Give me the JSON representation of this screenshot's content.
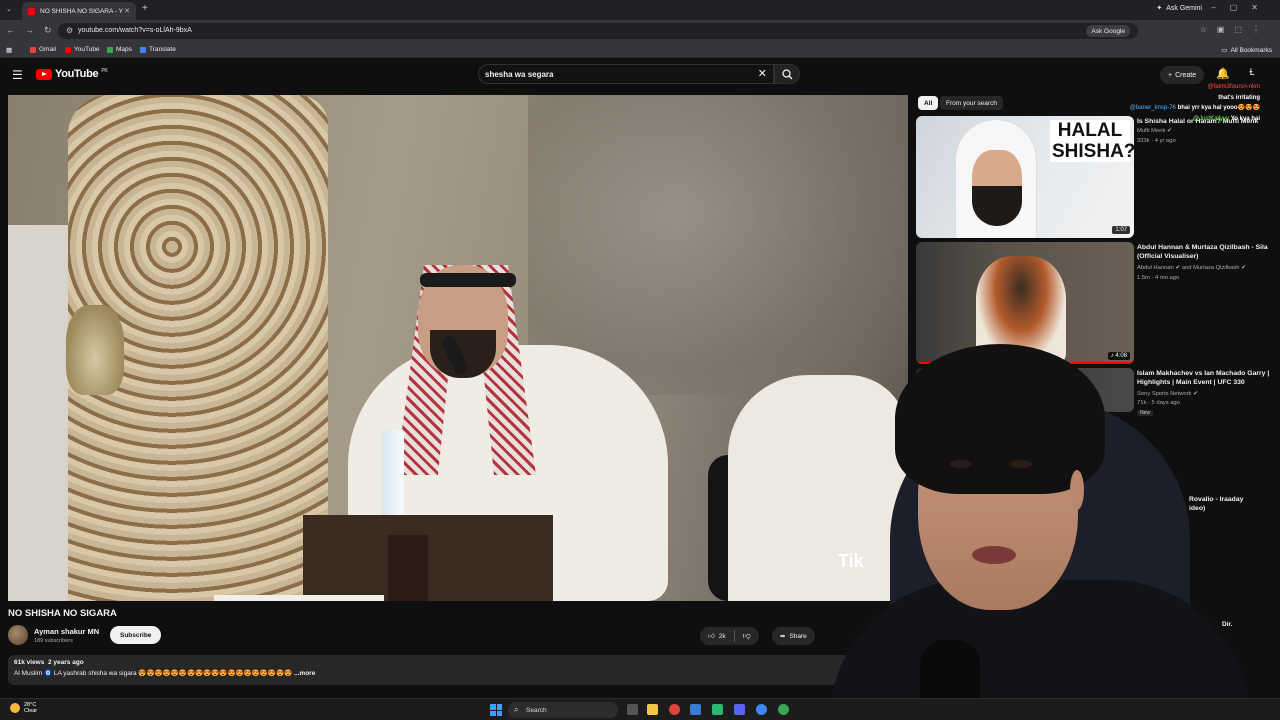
{
  "browser": {
    "tab_title": "NO SHISHA NO SIGARA - Y",
    "new_tab_icon": "plus-icon",
    "ask_gemini": "Ask Gemini",
    "url": "youtube.com/watch?v=s-oLlAh-9bxA",
    "ask_google": "Ask Google",
    "bookmarks": [
      {
        "label": "Gmail",
        "color": "#ea4335"
      },
      {
        "label": "YouTube",
        "color": "#ff0000"
      },
      {
        "label": "Maps",
        "color": "#34a853"
      },
      {
        "label": "Translate",
        "color": "#4285f4"
      }
    ],
    "all_bookmarks": "All Bookmarks"
  },
  "youtube": {
    "logo_text": "YouTube",
    "country": "PK",
    "search_value": "shesha wa segara",
    "create_label": "Create",
    "accent": "#ff0000"
  },
  "video": {
    "title": "NO SHISHA NO SIGARA",
    "watermark": "Tik",
    "channel": "Ayman shakur MN",
    "subscribers": "189 subscribers",
    "subscribe_label": "Subscribe",
    "likes": "2k",
    "share_label": "Share",
    "views": "61k views",
    "age": "2 years ago",
    "description": "Al Muslim 🧿 LA yashrab shisha wa sigara 😍😍😍😍😍😍😍😍😍😍😍😍😍😍😍😍😍😍😍",
    "more_label": "...more"
  },
  "sidebar": {
    "chips": [
      "All",
      "From your search"
    ],
    "items": [
      {
        "title": "Is Shisha Halal or Haram? Mufti Menk",
        "channel": "Mufti Menk",
        "views": "333k",
        "age": "4 yr ago",
        "duration": "1:07",
        "thumb_text": "HALAL SHISHA?"
      },
      {
        "title": "Abdul Hannan & Murtaza Qizilbash - Sila (Official Visualiser)",
        "channel": "Abdul Hannan",
        "channel2": "and Murtaza Qizilbash",
        "views": "1.5m",
        "age": "4 mo ago",
        "duration": "4:08"
      },
      {
        "title": "Islam Makhachev vs Ian Machado Garry | Highlights | Main Event | UFC 330",
        "channel": "Sony Sports Network",
        "views": "71k",
        "age": "5 days ago",
        "badge": "New"
      }
    ],
    "partial_1": "Rovalio - Iraaday",
    "partial_1b": "ideo)",
    "partial_2": "Dir."
  },
  "chat": [
    {
      "user": "@fakm3foursn-nkm",
      "msg": "that's irritating",
      "color": "#ff4d4d"
    },
    {
      "user": "@baner_knsp-76",
      "msg": "bhai yrr kya hal yooo😍😍😍",
      "color": "#4fb3ff"
    },
    {
      "user": "@JustKallyyy",
      "msg": "Yo kya hai",
      "color": "#7cff5a"
    }
  ],
  "taskbar": {
    "temperature": "28°C",
    "weather": "Clear",
    "search": "Search"
  }
}
